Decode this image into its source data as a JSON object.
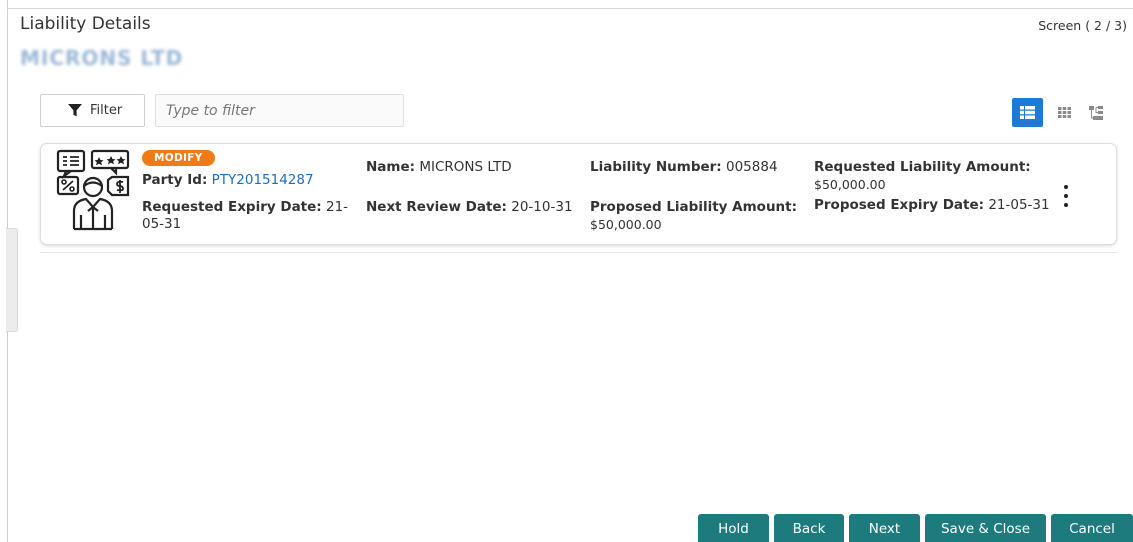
{
  "page": {
    "title": "Liability Details",
    "screen_indicator": "Screen ( 2 / 3)",
    "party_name": "MICRONS LTD"
  },
  "toolbar": {
    "filter_label": "Filter",
    "filter_placeholder": "Type to filter",
    "views": [
      "list-view-icon",
      "grid-view-icon",
      "tree-view-icon"
    ],
    "active_view": "list-view-icon",
    "active_color": "#1d7ad6"
  },
  "liability": {
    "badge": "MODIFY",
    "badge_color": "#f07b16",
    "icon": "customer-finance-icon",
    "party_id_label": "Party Id:",
    "party_id": "PTY201514287",
    "requested_expiry_label": "Requested Expiry Date:",
    "requested_expiry": "21-05-31",
    "name_label": "Name:",
    "name": "MICRONS LTD",
    "next_review_label": "Next Review Date:",
    "next_review": "20-10-31",
    "liability_number_label": "Liability Number:",
    "liability_number": "005884",
    "proposed_amount_label": "Proposed Liability Amount:",
    "proposed_amount": "$50,000.00",
    "requested_amount_label": "Requested Liability Amount:",
    "requested_amount": "$50,000.00",
    "proposed_expiry_label": "Proposed Expiry Date:",
    "proposed_expiry": "21-05-31"
  },
  "footer": {
    "hold": "Hold",
    "back": "Back",
    "next": "Next",
    "save_close": "Save & Close",
    "cancel": "Cancel",
    "button_color": "#1e7b7d"
  }
}
